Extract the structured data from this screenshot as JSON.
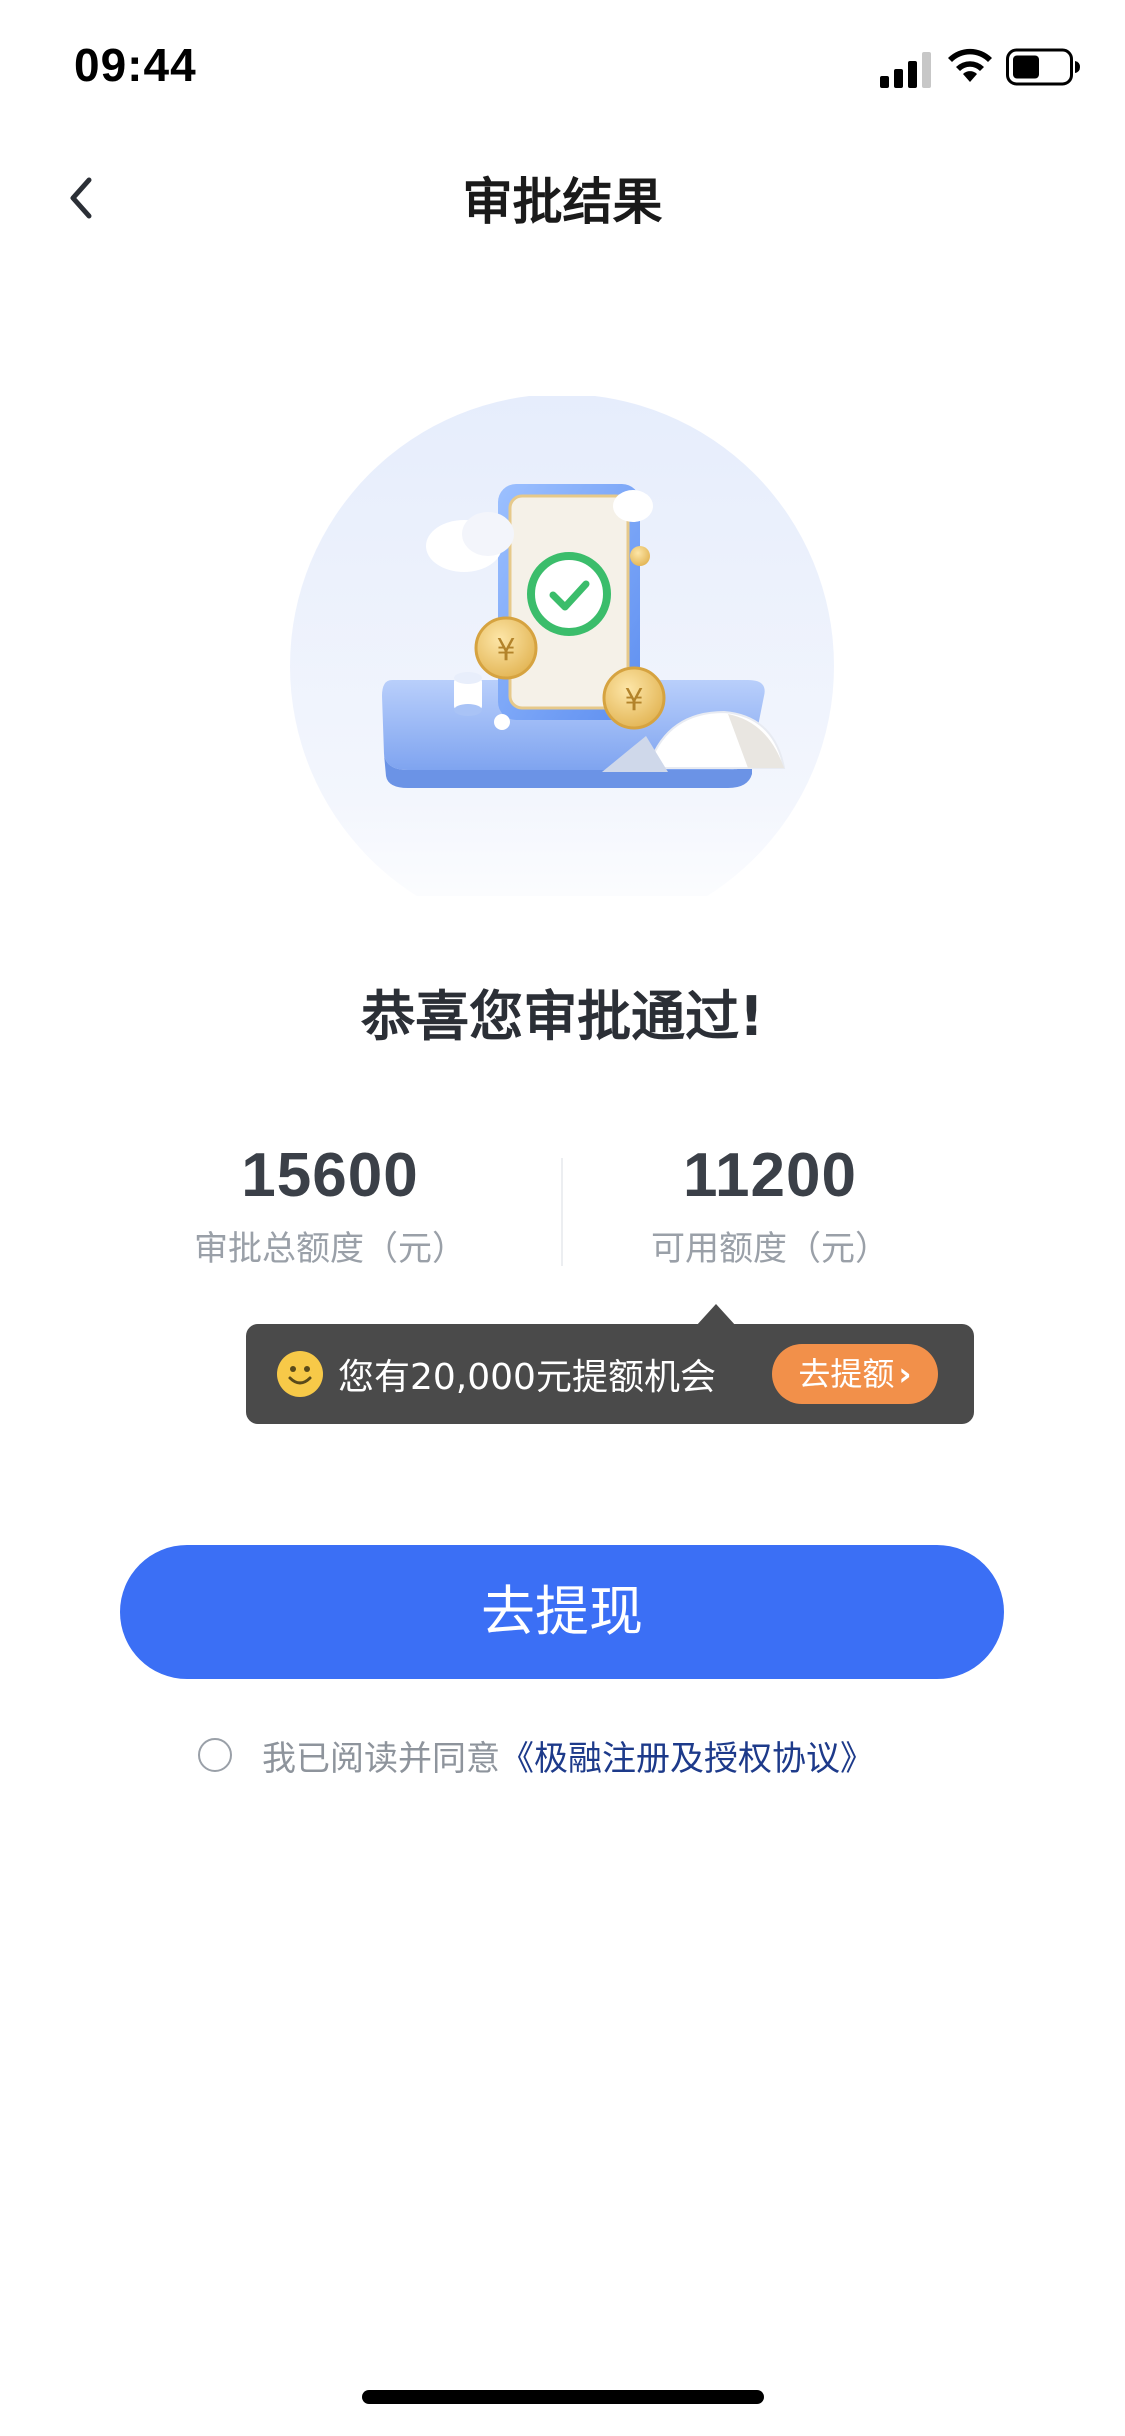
{
  "status_bar": {
    "time": "09:44",
    "icons": [
      "signal-icon",
      "wifi-icon",
      "battery-icon"
    ]
  },
  "nav": {
    "title": "审批结果",
    "back_icon": "chevron-left-icon"
  },
  "hero": {
    "illustration": "phone-approval-illustration"
  },
  "result": {
    "message": "恭喜您审批通过!"
  },
  "amounts": {
    "total": {
      "value": "15600",
      "label": "审批总额度（元）"
    },
    "available": {
      "value": "11200",
      "label": "可用额度（元）"
    }
  },
  "tooltip": {
    "icon": "smile-icon",
    "text": "您有20,000元提额机会",
    "button_label": "去提额",
    "button_chevron": "›"
  },
  "primary_action": {
    "label": "去提现"
  },
  "agreement": {
    "prefix": "我已阅读并同意",
    "link": "《极融注册及授权协议》"
  },
  "colors": {
    "primary": "#3b6ff5",
    "tooltip_bg": "#4a4a4a",
    "tooltip_button": "#f2904a",
    "link": "#1d3a8a"
  }
}
